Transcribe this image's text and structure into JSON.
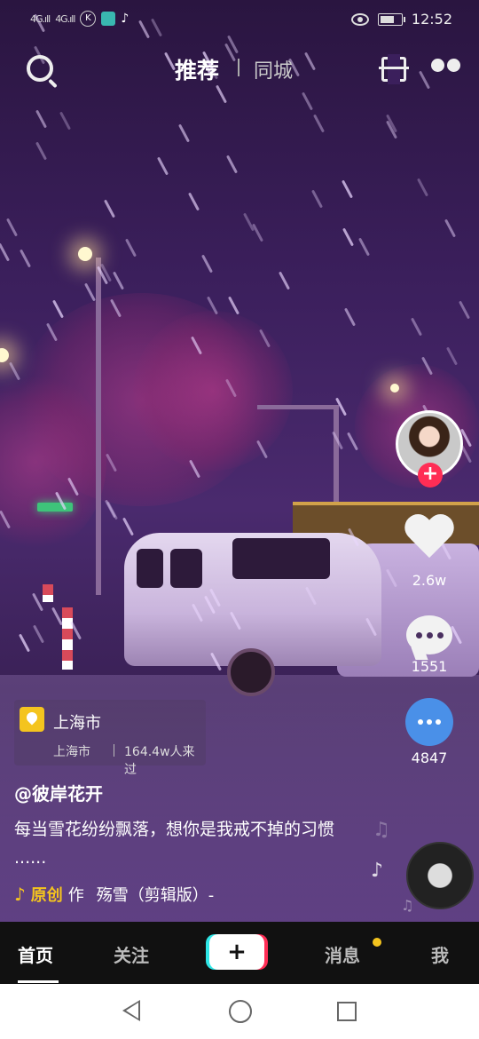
{
  "status_bar": {
    "signal1": "4G.ıll",
    "signal2": "4G.ıll",
    "k_icon": "K",
    "time": "12:52",
    "battery_level": 0.7
  },
  "top_bar": {
    "tab_recommend": "推荐",
    "tab_city": "同城"
  },
  "right_actions": {
    "like_count": "2.6w",
    "comment_count": "1551",
    "share_count": "4847",
    "follow_symbol": "+"
  },
  "location": {
    "name": "上海市",
    "city": "上海市",
    "visitors": "164.4w人来过"
  },
  "post": {
    "author": "@彼岸花开",
    "caption": "每当雪花纷纷飘落，想你是我戒不掉的习惯 ......",
    "music_label": "原创",
    "music_prefix": "作",
    "music_title": "殇雪（剪辑版）-"
  },
  "bottom_nav": {
    "home": "首页",
    "following": "关注",
    "plus": "+",
    "messages": "消息",
    "me": "我"
  },
  "colors": {
    "accent_pink": "#ff2d55",
    "accent_cyan": "#2ee6e6",
    "accent_yellow": "#f4c41e",
    "share_blue": "#4a90e8"
  },
  "icons": [
    "search-icon",
    "scan-icon",
    "dots-icon",
    "heart-icon",
    "comment-icon",
    "share-icon",
    "location-pin-icon",
    "music-note-icon",
    "music-disc-icon",
    "back-icon",
    "home-icon",
    "recent-apps-icon"
  ]
}
